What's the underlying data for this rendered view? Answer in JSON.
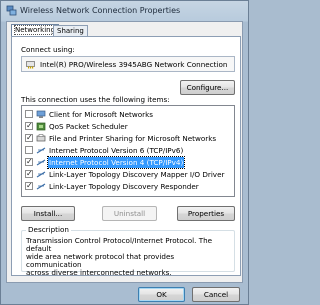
{
  "window": {
    "title": "Wireless Network Connection Properties"
  },
  "tabs": [
    {
      "label": "Networking",
      "active": true
    },
    {
      "label": "Sharing",
      "active": false
    }
  ],
  "connect_using": {
    "label": "Connect using:",
    "adapter": "Intel(R) PRO/Wireless 3945ABG Network Connection",
    "configure_button": "Configure..."
  },
  "items_label": "This connection uses the following items:",
  "items": [
    {
      "label": "Client for Microsoft Networks",
      "checked": true,
      "icon": "client-icon"
    },
    {
      "label": "QoS Packet Scheduler",
      "checked": true,
      "icon": "qos-scheduler-icon"
    },
    {
      "label": "File and Printer Sharing for Microsoft Networks",
      "checked": true,
      "icon": "file-printer-icon"
    },
    {
      "label": "Internet Protocol Version 6 (TCP/IPv6)",
      "checked": false,
      "icon": "protocol-icon"
    },
    {
      "label": "Internet Protocol Version 4 (TCP/IPv4)",
      "checked": true,
      "icon": "protocol-icon",
      "selected": true
    },
    {
      "label": "Link-Layer Topology Discovery Mapper I/O Driver",
      "checked": true,
      "icon": "protocol-icon"
    },
    {
      "label": "Link-Layer Topology Discovery Responder",
      "checked": true,
      "icon": "protocol-icon"
    }
  ],
  "buttons": {
    "install": "Install...",
    "uninstall": "Uninstall",
    "properties": "Properties",
    "ok": "OK",
    "cancel": "Cancel"
  },
  "description": {
    "title": "Description",
    "lines": [
      "Transmission Control Protocol/Internet Protocol. The default",
      "wide area network protocol that provides communication",
      "across diverse interconnected networks."
    ]
  },
  "colors": {
    "selection": "#3399ff",
    "window_frame": "#a9bdd1"
  }
}
